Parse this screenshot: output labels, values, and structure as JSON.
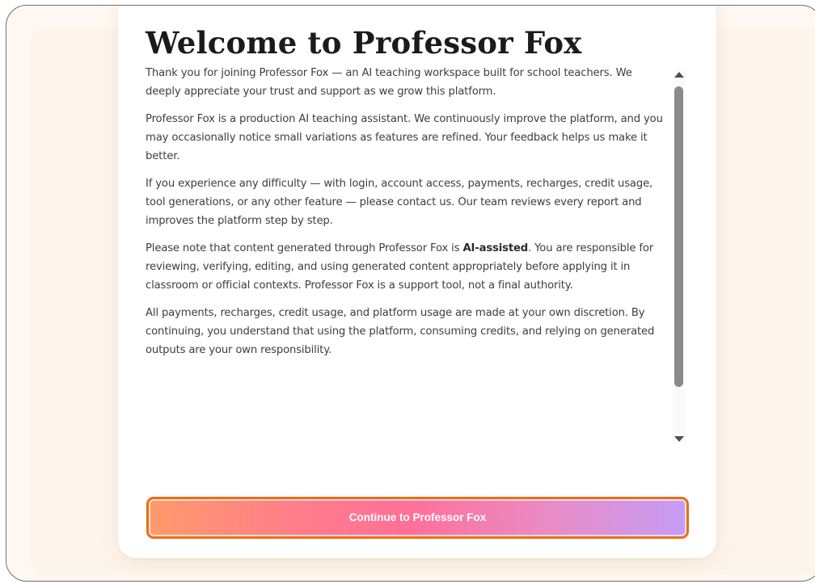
{
  "modal": {
    "title": "Welcome to Professor Fox",
    "paragraphs": {
      "p1": "Thank you for joining Professor Fox — an AI teaching workspace built for school teachers. We deeply appreciate your trust and support as we grow this platform.",
      "p2": "Professor Fox is a production AI teaching assistant. We continuously improve the platform, and you may occasionally notice small variations as features are refined. Your feedback helps us make it better.",
      "p3": "If you experience any difficulty — with login, account access, payments, recharges, credit usage, tool generations, or any other feature — please contact us. Our team reviews every report and improves the platform step by step.",
      "p4_before": "Please note that content generated through Professor Fox is ",
      "p4_bold": "AI-assisted",
      "p4_after": ". You are responsible for reviewing, verifying, editing, and using generated content appropriately before applying it in classroom or official contexts. Professor Fox is a support tool, not a final authority.",
      "p5": "All payments, recharges, credit usage, and platform usage are made at your own discretion. By continuing, you understand that using the platform, consuming credits, and relying on generated outputs are your own responsibility."
    },
    "continue_label": "Continue to Professor Fox"
  },
  "colors": {
    "button_border": "#ee6d14",
    "button_gradient_start": "#ff9a6b",
    "button_gradient_end": "#c49cf6",
    "page_background": "#fdf4ec"
  },
  "icons": {
    "scroll_up": "triangle-up-icon",
    "scroll_down": "triangle-down-icon"
  }
}
